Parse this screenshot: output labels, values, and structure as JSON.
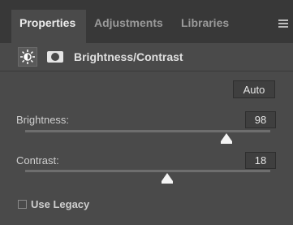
{
  "tabs": [
    {
      "label": "Properties",
      "active": true
    },
    {
      "label": "Adjustments",
      "active": false
    },
    {
      "label": "Libraries",
      "active": false
    }
  ],
  "header": {
    "title": "Brightness/Contrast",
    "adjustment_icon": "sun-adjustment-icon",
    "mask_icon": "layer-mask-icon"
  },
  "auto_button": {
    "label": "Auto"
  },
  "brightness": {
    "label": "Brightness:",
    "value": "98",
    "fraction": 0.82
  },
  "contrast": {
    "label": "Contrast:",
    "value": "18",
    "fraction": 0.58
  },
  "legacy": {
    "label": "Use Legacy",
    "checked": false
  },
  "colors": {
    "panel_bg": "#4a4a4a",
    "tabbar_bg": "#383838",
    "text": "#d6d6d6"
  }
}
